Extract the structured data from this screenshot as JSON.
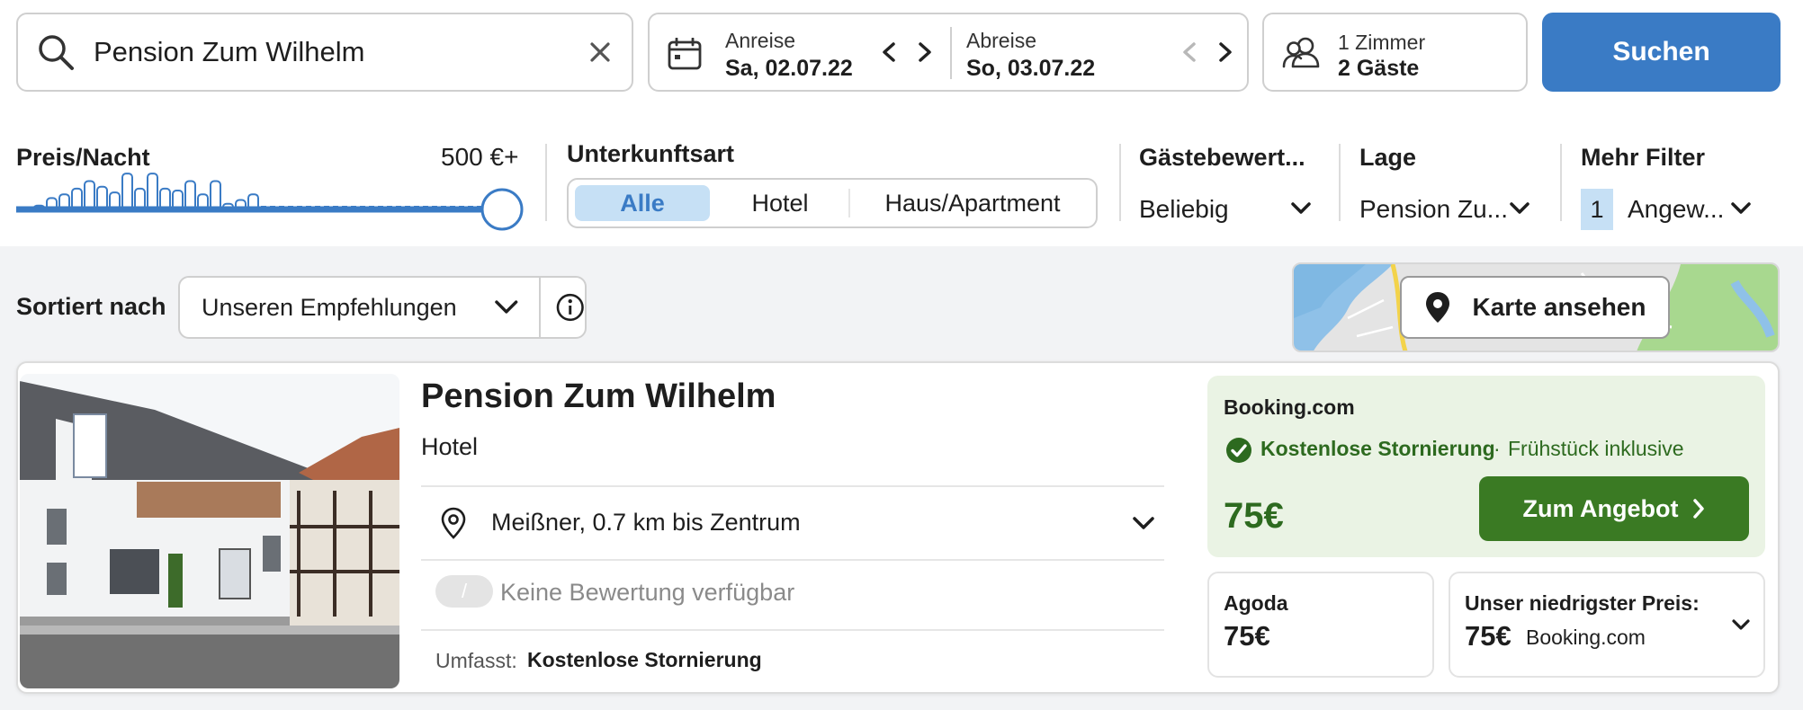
{
  "search": {
    "query": "Pension Zum Wilhelm"
  },
  "dates": {
    "checkin_label": "Anreise",
    "checkin_value": "Sa, 02.07.22",
    "checkout_label": "Abreise",
    "checkout_value": "So, 03.07.22"
  },
  "guests": {
    "rooms": "1 Zimmer",
    "guests": "2 Gäste"
  },
  "search_button": "Suchen",
  "filters": {
    "price": {
      "label": "Preis/Nacht",
      "max": "500 €+",
      "histogram": [
        0.1,
        0.3,
        0.4,
        0.55,
        0.75,
        0.6,
        0.45,
        0.95,
        0.55,
        0.95,
        0.55,
        0.5,
        0.75,
        0.4,
        0.75,
        0.15,
        0.25,
        0.4
      ]
    },
    "type": {
      "label": "Unterkunftsart",
      "options": [
        "Alle",
        "Hotel",
        "Haus/Apartment"
      ],
      "selected": "Alle"
    },
    "rating": {
      "label": "Gästebewert...",
      "value": "Beliebig"
    },
    "location": {
      "label": "Lage",
      "value": "Pension Zu..."
    },
    "more": {
      "label": "Mehr Filter",
      "count": "1",
      "value": "Angew..."
    }
  },
  "sort": {
    "label": "Sortiert nach",
    "value": "Unseren Empfehlungen"
  },
  "map": {
    "button": "Karte ansehen"
  },
  "hotel": {
    "name": "Pension Zum Wilhelm",
    "type": "Hotel",
    "location": "Meißner, 0.7 km bis Zentrum",
    "rating_badge": "/",
    "rating_text": "Keine Bewertung verfügbar",
    "includes_label": "Umfasst:",
    "includes_value": "Kostenlose Stornierung"
  },
  "deal": {
    "provider": "Booking.com",
    "cancellation": "Kostenlose Stornierung",
    "separator": "·",
    "breakfast": "Frühstück inklusive",
    "price": "75€",
    "button": "Zum Angebot"
  },
  "alt_deals": [
    {
      "provider": "Agoda",
      "price": "75€"
    }
  ],
  "lowest": {
    "label": "Unser niedrigster Preis:",
    "price": "75€",
    "provider": "Booking.com"
  },
  "colors": {
    "accent": "#3a7bc5",
    "deal_green": "#3a7a23",
    "deal_bg": "#eaf3e4"
  }
}
